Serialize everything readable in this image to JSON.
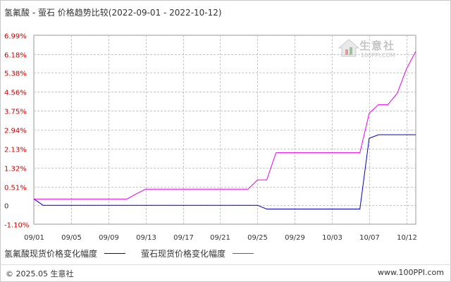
{
  "title": "氢氟酸 - 萤石 价格趋势比较(2022-09-01 - 2022-10-12)",
  "watermark": {
    "name": "生意社",
    "url": "100PPI.COM"
  },
  "legend": {
    "series1": "氢氟酸现货价格变化幅度",
    "series2": "萤石现货价格变化幅度"
  },
  "footer": {
    "left": "© 2025.05 生意社",
    "right": "www.100PPI.com"
  },
  "colors": {
    "series1": "#0000cc",
    "series2": "#ee00ee",
    "ytick": "#cc0000",
    "zero_tick": "#333333",
    "grid": "#c8c8c8"
  },
  "chart_data": {
    "type": "line",
    "title": "氢氟酸 - 萤石 价格趋势比较(2022-09-01 - 2022-10-12)",
    "xlabel": "",
    "ylabel": "",
    "y_ticks": [
      "6.99%",
      "6.18%",
      "5.38%",
      "4.56%",
      "3.75%",
      "2.94%",
      "2.13%",
      "1.32%",
      "0.51%",
      "0",
      "-1.10%"
    ],
    "y_tick_values": [
      6.99,
      6.18,
      5.38,
      4.56,
      3.75,
      2.94,
      2.13,
      1.32,
      0.51,
      -0.29,
      -1.1
    ],
    "x_ticks": [
      "09/01",
      "09/05",
      "09/09",
      "09/13",
      "09/17",
      "09/21",
      "09/25",
      "09/29",
      "10/03",
      "10/07",
      "10/12"
    ],
    "x_tick_dates": [
      "2022-09-01",
      "2022-09-05",
      "2022-09-09",
      "2022-09-13",
      "2022-09-17",
      "2022-09-21",
      "2022-09-25",
      "2022-09-29",
      "2022-10-03",
      "2022-10-07",
      "2022-10-11"
    ],
    "ylim": [
      -1.1,
      6.99
    ],
    "xlim": [
      "2022-09-01",
      "2022-10-12"
    ],
    "grid": true,
    "series": [
      {
        "name": "氢氟酸现货价格变化幅度",
        "color": "#0000cc",
        "points": [
          [
            "2022-09-01",
            -0.02
          ],
          [
            "2022-09-02",
            -0.29
          ],
          [
            "2022-09-25",
            -0.29
          ],
          [
            "2022-09-26",
            -0.45
          ],
          [
            "2022-10-06",
            -0.45
          ],
          [
            "2022-10-07",
            2.58
          ],
          [
            "2022-10-08",
            2.73
          ],
          [
            "2022-10-12",
            2.73
          ]
        ]
      },
      {
        "name": "萤石现货价格变化幅度",
        "color": "#ee00ee",
        "points": [
          [
            "2022-09-01",
            -0.02
          ],
          [
            "2022-09-11",
            -0.02
          ],
          [
            "2022-09-12",
            0.2
          ],
          [
            "2022-09-13",
            0.4
          ],
          [
            "2022-09-24",
            0.4
          ],
          [
            "2022-09-25",
            0.8
          ],
          [
            "2022-09-26",
            0.8
          ],
          [
            "2022-09-27",
            1.96
          ],
          [
            "2022-10-06",
            1.96
          ],
          [
            "2022-10-07",
            3.65
          ],
          [
            "2022-10-08",
            4.02
          ],
          [
            "2022-10-09",
            4.02
          ],
          [
            "2022-10-10",
            4.5
          ],
          [
            "2022-10-11",
            5.55
          ],
          [
            "2022-10-12",
            6.3
          ]
        ]
      }
    ]
  }
}
